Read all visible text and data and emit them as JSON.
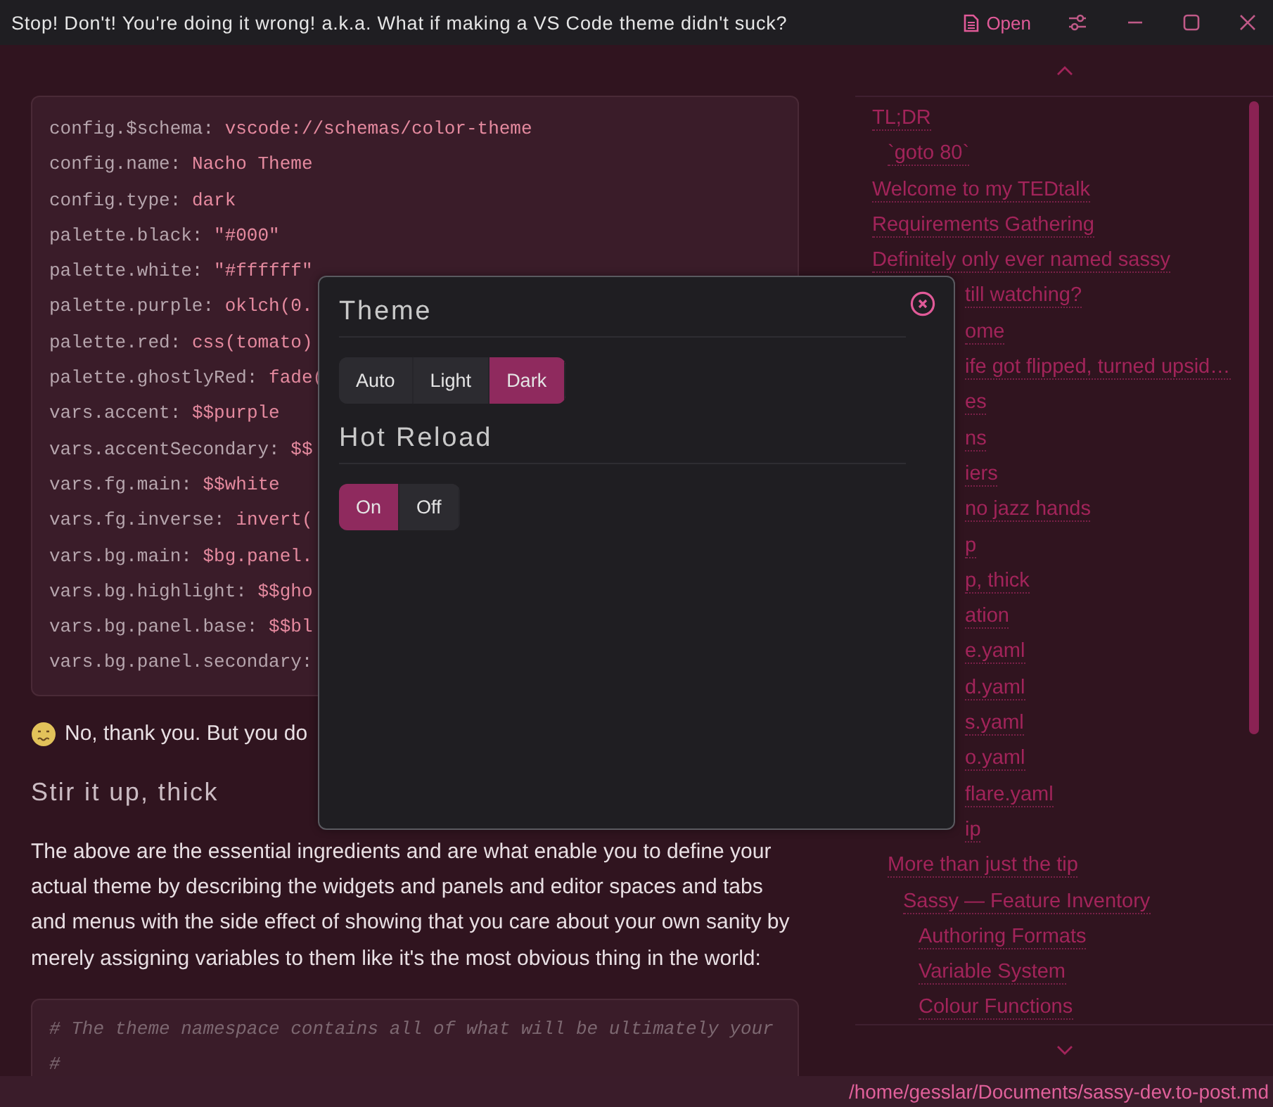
{
  "window": {
    "title": "Stop! Don't! You're doing it wrong! a.k.a. What if making a VS Code theme didn't suck?",
    "open_label": "Open"
  },
  "article": {
    "code_lines": [
      {
        "key": "config.$schema:",
        "value": "vscode://schemas/color-theme"
      },
      {
        "key": "config.name:",
        "value": "Nacho Theme"
      },
      {
        "key": "config.type:",
        "value": "dark"
      },
      {
        "key": "palette.black:",
        "value": "\"#000\""
      },
      {
        "key": "palette.white:",
        "value": "\"#ffffff\""
      },
      {
        "key": "palette.purple:",
        "value": "oklch(0."
      },
      {
        "key": "palette.red:",
        "value": "css(tomato)"
      },
      {
        "key": "palette.ghostlyRed:",
        "value": "fade("
      },
      {
        "key": "vars.accent:",
        "value": "$$purple"
      },
      {
        "key": "vars.accentSecondary:",
        "value": "$$"
      },
      {
        "key": "vars.fg.main:",
        "value": "$$white"
      },
      {
        "key": "vars.fg.inverse:",
        "value": "invert("
      },
      {
        "key": "vars.bg.main:",
        "value": "$bg.panel."
      },
      {
        "key": "vars.bg.highlight:",
        "value": "$$gho"
      },
      {
        "key": "vars.bg.panel.base:",
        "value": "$$bl"
      },
      {
        "key": "vars.bg.panel.secondary:"
      }
    ],
    "reply": "No, thank you. But you do",
    "heading": "Stir it up, thick",
    "paragraph": "The above are the essential ingredients and are what enable you to define your actual theme by describing the widgets and panels and editor spaces and tabs and menus with the side effect of showing that you care about your own sanity by merely assigning variables to them like it's the most obvious thing in the world:",
    "code_comment_lines": [
      "# The theme namespace contains all of what will be ultimately your",
      "#"
    ]
  },
  "toc": {
    "items": [
      {
        "kind": "link",
        "text": "TL;DR",
        "children": [
          {
            "kind": "link",
            "text": "`goto 80`"
          }
        ]
      },
      {
        "kind": "link",
        "text": "Welcome to my TEDtalk"
      },
      {
        "kind": "link",
        "text": "Requirements Gathering"
      },
      {
        "kind": "link",
        "text": "Definitely only ever named sassy"
      },
      {
        "kind": "covered",
        "text": "till watching?"
      },
      {
        "kind": "covered",
        "text": "ome"
      },
      {
        "kind": "covered",
        "text": "ife got flipped, turned upsid…"
      },
      {
        "kind": "covered",
        "text": "es"
      },
      {
        "kind": "covered",
        "text": "ns"
      },
      {
        "kind": "covered",
        "text": "iers"
      },
      {
        "kind": "covered",
        "text": "no jazz hands"
      },
      {
        "kind": "covered",
        "text": "p"
      },
      {
        "kind": "covered",
        "text": "p, thick"
      },
      {
        "kind": "covered",
        "text": "ation"
      },
      {
        "kind": "covered",
        "text": "e.yaml"
      },
      {
        "kind": "covered",
        "text": "d.yaml"
      },
      {
        "kind": "covered",
        "text": "s.yaml"
      },
      {
        "kind": "covered",
        "text": "o.yaml"
      },
      {
        "kind": "covered",
        "text": "flare.yaml"
      },
      {
        "kind": "covered",
        "text": "ip",
        "children": [
          {
            "kind": "link",
            "text": "More than just the tip",
            "children": [
              {
                "kind": "link",
                "text": "Sassy — Feature Inventory",
                "children": [
                  {
                    "kind": "link",
                    "text": "Authoring Formats"
                  },
                  {
                    "kind": "link",
                    "text": "Variable System"
                  },
                  {
                    "kind": "link",
                    "text": "Colour Functions"
                  }
                ]
              }
            ]
          }
        ]
      }
    ]
  },
  "dialog": {
    "sections": [
      {
        "title": "Theme",
        "options": [
          {
            "label": "Auto",
            "selected": false
          },
          {
            "label": "Light",
            "selected": false
          },
          {
            "label": "Dark",
            "selected": true
          }
        ]
      },
      {
        "title": "Hot Reload",
        "options": [
          {
            "label": "On",
            "selected": true
          },
          {
            "label": "Off",
            "selected": false
          }
        ]
      }
    ]
  },
  "status_bar": {
    "path": "/home/gesslar/Documents/sassy-dev.to-post.md"
  }
}
